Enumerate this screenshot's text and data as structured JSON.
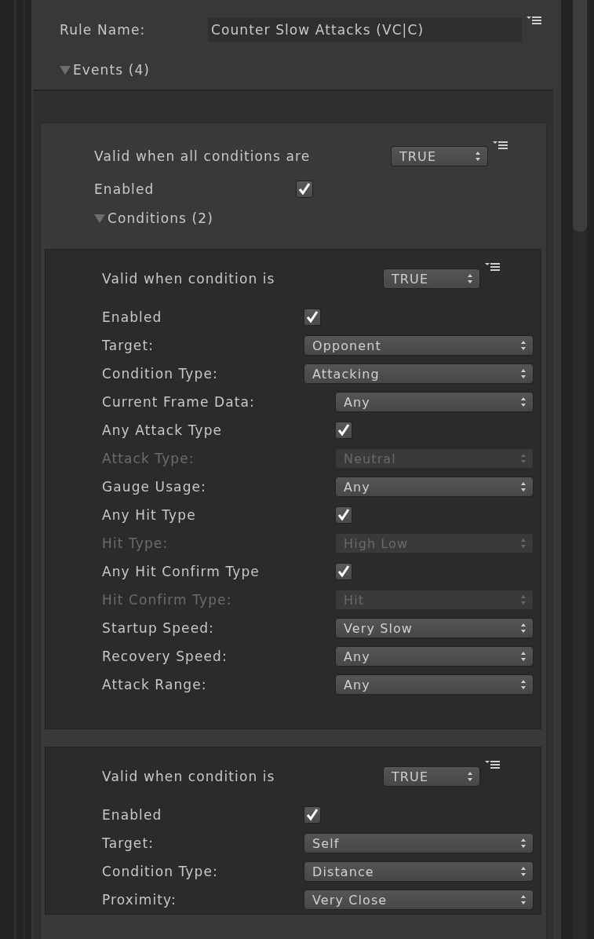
{
  "rule_name": {
    "label": "Rule Name:",
    "value": "Counter Slow Attacks (VC|C)"
  },
  "events": {
    "label": "Events (4)",
    "expanded": true,
    "event": {
      "valid_label": "Valid when all conditions are",
      "valid_value": "TRUE",
      "enabled_label": "Enabled",
      "enabled": true,
      "conditions": {
        "label": "Conditions (2)",
        "expanded": true,
        "items": [
          {
            "valid_label": "Valid when condition is",
            "valid_value": "TRUE",
            "rows": [
              {
                "kind": "checkbox",
                "label": "Enabled",
                "checked": true,
                "nested": false,
                "disabled": false
              },
              {
                "kind": "dropdown",
                "label": "Target:",
                "value": "Opponent",
                "nested": false,
                "disabled": false
              },
              {
                "kind": "dropdown",
                "label": "Condition Type:",
                "value": "Attacking",
                "nested": false,
                "disabled": false
              },
              {
                "kind": "dropdown",
                "label": "Current Frame Data:",
                "value": "Any",
                "nested": true,
                "disabled": false
              },
              {
                "kind": "checkbox",
                "label": "Any Attack Type",
                "checked": true,
                "nested": true,
                "disabled": false
              },
              {
                "kind": "dropdown",
                "label": "Attack Type:",
                "value": "Neutral",
                "nested": true,
                "disabled": true
              },
              {
                "kind": "dropdown",
                "label": "Gauge Usage:",
                "value": "Any",
                "nested": true,
                "disabled": false
              },
              {
                "kind": "checkbox",
                "label": "Any Hit Type",
                "checked": true,
                "nested": true,
                "disabled": false
              },
              {
                "kind": "dropdown",
                "label": "Hit Type:",
                "value": "High Low",
                "nested": true,
                "disabled": true
              },
              {
                "kind": "checkbox",
                "label": "Any Hit Confirm Type",
                "checked": true,
                "nested": true,
                "disabled": false
              },
              {
                "kind": "dropdown",
                "label": "Hit Confirm Type:",
                "value": "Hit",
                "nested": true,
                "disabled": true
              },
              {
                "kind": "dropdown",
                "label": "Startup Speed:",
                "value": "Very Slow",
                "nested": true,
                "disabled": false
              },
              {
                "kind": "dropdown",
                "label": "Recovery Speed:",
                "value": "Any",
                "nested": true,
                "disabled": false
              },
              {
                "kind": "dropdown",
                "label": "Attack Range:",
                "value": "Any",
                "nested": true,
                "disabled": false
              }
            ]
          },
          {
            "valid_label": "Valid when condition is",
            "valid_value": "TRUE",
            "rows": [
              {
                "kind": "checkbox",
                "label": "Enabled",
                "checked": true,
                "nested": false,
                "disabled": false
              },
              {
                "kind": "dropdown",
                "label": "Target:",
                "value": "Self",
                "nested": false,
                "disabled": false
              },
              {
                "kind": "dropdown",
                "label": "Condition Type:",
                "value": "Distance",
                "nested": false,
                "disabled": false
              },
              {
                "kind": "dropdown",
                "label": "Proximity:",
                "value": "Very Close",
                "nested": false,
                "disabled": false
              }
            ]
          }
        ]
      }
    }
  }
}
